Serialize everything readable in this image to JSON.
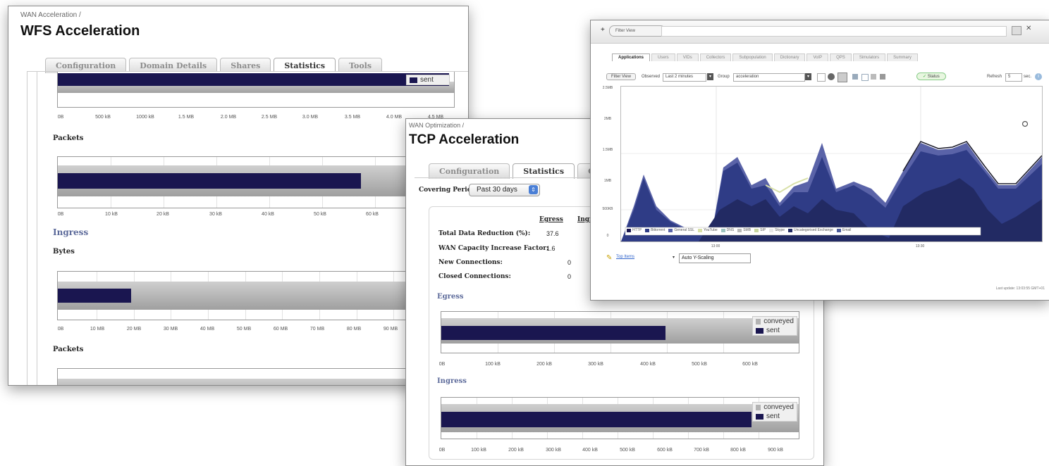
{
  "wfs": {
    "breadcrumb": "WAN Acceleration /",
    "title": "WFS Acceleration",
    "tabs": [
      {
        "label": "Configuration",
        "active": false
      },
      {
        "label": "Domain Details",
        "active": false
      },
      {
        "label": "Shares",
        "active": false
      },
      {
        "label": "Statistics",
        "active": true
      },
      {
        "label": "Tools",
        "active": false
      }
    ],
    "egress_bytes_legend": "sent",
    "egress_bytes_ticks": [
      "0B",
      "500 kB",
      "1000 kB",
      "1.5 MB",
      "2.0 MB",
      "2.5 MB",
      "3.0 MB",
      "3.5 MB",
      "4.0 MB",
      "4.5 MB"
    ],
    "packets_label": "Packets",
    "egress_packets_ticks": [
      "0B",
      "10 kB",
      "20 kB",
      "30 kB",
      "40 kB",
      "50 kB",
      "60 kB"
    ],
    "ingress_label": "Ingress",
    "bytes_label": "Bytes",
    "ingress_bytes_ticks": [
      "0B",
      "10 MB",
      "20 MB",
      "30 MB",
      "40 MB",
      "50 MB",
      "60 MB",
      "70 MB",
      "80 MB",
      "90 MB"
    ],
    "packets_label2": "Packets"
  },
  "tcp": {
    "breadcrumb": "WAN Optimization /",
    "title": "TCP Acceleration",
    "tabs": [
      {
        "label": "Configuration",
        "active": false
      },
      {
        "label": "Statistics",
        "active": true
      },
      {
        "label": "Connecti",
        "active": false
      }
    ],
    "covering_label": "Covering Period:",
    "covering_value": "Past 30 days",
    "col_egress": "Egress",
    "col_ingress": "Ingr",
    "stats": [
      {
        "label": "Total Data Reduction (%):",
        "value": "37.6"
      },
      {
        "label": "WAN Capacity Increase Factor:",
        "value": "1.6"
      },
      {
        "label": "New Connections:",
        "value": "0"
      },
      {
        "label": "Closed Connections:",
        "value": "0"
      }
    ],
    "egress_label": "Egress",
    "ingress_label": "Ingress",
    "legend_conveyed": "conveyed",
    "legend_sent": "sent",
    "egress_ticks": [
      "0B",
      "100 kB",
      "200 kB",
      "300 kB",
      "400 kB",
      "500 kB",
      "600 kB"
    ],
    "ingress_ticks": [
      "0B",
      "100 kB",
      "200 kB",
      "300 kB",
      "400 kB",
      "500 kB",
      "600 kB",
      "700 kB",
      "800 kB",
      "900 kB"
    ]
  },
  "view": {
    "tab_chip": "Filter View",
    "tabs": [
      "Applications",
      "Users",
      "VIDs",
      "Collectors",
      "Subpopulation",
      "Dictionary",
      "VoIP",
      "QPS",
      "Simulators",
      "Summary"
    ],
    "toolbar": {
      "filter_btn": "Filter View",
      "observe_label": "Observed",
      "observe_value": "Last 2 minutes",
      "group_label": "Group",
      "group_value": "acceleration",
      "status_btn": "Status",
      "refresh_label": "Refresh",
      "refresh_value": "5",
      "refresh_unit": "sec."
    },
    "y_ticks": [
      "2.5MB",
      "2MB",
      "1.5MB",
      "1MB",
      "500KB",
      "0"
    ],
    "x_ticks": [
      "13:00",
      "13:30"
    ],
    "legend_items": [
      "HTTP",
      "Bittorrent",
      "General SSL",
      "YouTube",
      "DNS",
      "SMB",
      "SIP",
      "Skype",
      "Uncategorised Exchange",
      "Email"
    ],
    "top_dropdown": "Top Items",
    "scaling_field": "Auto Y-Scaling",
    "footer": "Last update: 13:03:55 GMT+01"
  },
  "colors": {
    "bar_navy": "#1a1650",
    "band_gray": "#b3b3b3",
    "accent_link": "#5c6a9a"
  }
}
